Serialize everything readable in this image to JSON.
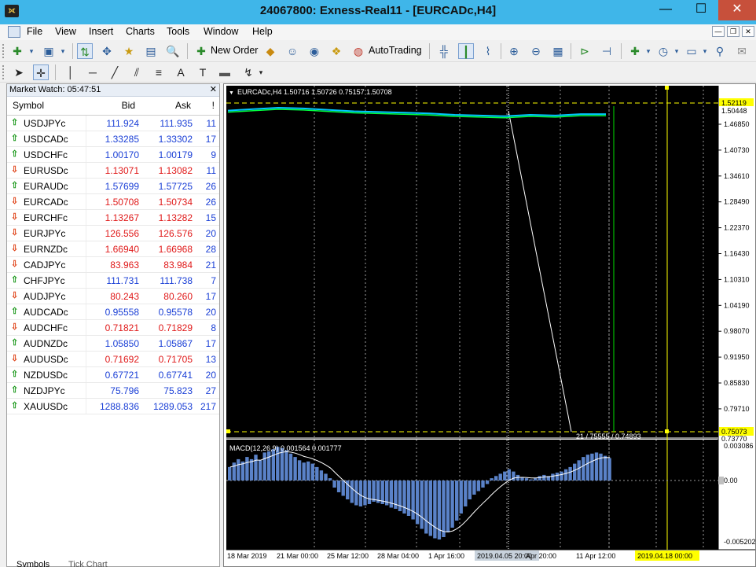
{
  "window": {
    "title": "24067800: Exness-Real11 - [EURCADc,H4]",
    "logo_glyph": "⟗",
    "minimize": "—",
    "maximize": "☐",
    "close": "✕"
  },
  "menu": {
    "items": [
      "File",
      "View",
      "Insert",
      "Charts",
      "Tools",
      "Window",
      "Help"
    ],
    "mdi_minimize": "—",
    "mdi_restore": "❐",
    "mdi_close": "✕"
  },
  "toolbar": {
    "new_order": "New Order",
    "autotrading": "AutoTrading"
  },
  "market_watch": {
    "title": "Market Watch: 05:47:51",
    "close": "✕",
    "columns": {
      "symbol": "Symbol",
      "bid": "Bid",
      "ask": "Ask",
      "spread": "!"
    },
    "rows": [
      {
        "symbol": "USDJPYc",
        "dir": "up",
        "bid": "111.924",
        "ask": "111.935",
        "spread": "11",
        "color": "blue"
      },
      {
        "symbol": "USDCADc",
        "dir": "up",
        "bid": "1.33285",
        "ask": "1.33302",
        "spread": "17",
        "color": "blue"
      },
      {
        "symbol": "USDCHFc",
        "dir": "up",
        "bid": "1.00170",
        "ask": "1.00179",
        "spread": "9",
        "color": "blue"
      },
      {
        "symbol": "EURUSDc",
        "dir": "dn",
        "bid": "1.13071",
        "ask": "1.13082",
        "spread": "11",
        "color": "red"
      },
      {
        "symbol": "EURAUDc",
        "dir": "up",
        "bid": "1.57699",
        "ask": "1.57725",
        "spread": "26",
        "color": "blue"
      },
      {
        "symbol": "EURCADc",
        "dir": "dn",
        "bid": "1.50708",
        "ask": "1.50734",
        "spread": "26",
        "color": "red"
      },
      {
        "symbol": "EURCHFc",
        "dir": "dn",
        "bid": "1.13267",
        "ask": "1.13282",
        "spread": "15",
        "color": "red"
      },
      {
        "symbol": "EURJPYc",
        "dir": "dn",
        "bid": "126.556",
        "ask": "126.576",
        "spread": "20",
        "color": "red"
      },
      {
        "symbol": "EURNZDc",
        "dir": "dn",
        "bid": "1.66940",
        "ask": "1.66968",
        "spread": "28",
        "color": "red"
      },
      {
        "symbol": "CADJPYc",
        "dir": "dn",
        "bid": "83.963",
        "ask": "83.984",
        "spread": "21",
        "color": "red"
      },
      {
        "symbol": "CHFJPYc",
        "dir": "up",
        "bid": "111.731",
        "ask": "111.738",
        "spread": "7",
        "color": "blue"
      },
      {
        "symbol": "AUDJPYc",
        "dir": "dn",
        "bid": "80.243",
        "ask": "80.260",
        "spread": "17",
        "color": "red"
      },
      {
        "symbol": "AUDCADc",
        "dir": "up",
        "bid": "0.95558",
        "ask": "0.95578",
        "spread": "20",
        "color": "blue"
      },
      {
        "symbol": "AUDCHFc",
        "dir": "dn",
        "bid": "0.71821",
        "ask": "0.71829",
        "spread": "8",
        "color": "red"
      },
      {
        "symbol": "AUDNZDc",
        "dir": "up",
        "bid": "1.05850",
        "ask": "1.05867",
        "spread": "17",
        "color": "blue"
      },
      {
        "symbol": "AUDUSDc",
        "dir": "dn",
        "bid": "0.71692",
        "ask": "0.71705",
        "spread": "13",
        "color": "red"
      },
      {
        "symbol": "NZDUSDc",
        "dir": "up",
        "bid": "0.67721",
        "ask": "0.67741",
        "spread": "20",
        "color": "blue"
      },
      {
        "symbol": "NZDJPYc",
        "dir": "up",
        "bid": "75.796",
        "ask": "75.823",
        "spread": "27",
        "color": "blue"
      },
      {
        "symbol": "XAUUSDc",
        "dir": "up",
        "bid": "1288.836",
        "ask": "1289.053",
        "spread": "217",
        "color": "blue"
      }
    ],
    "tabs": [
      "Symbols",
      "Tick Chart"
    ]
  },
  "chart": {
    "symbol_header": "EURCADc,H4  1.50716 1.50726 0.75157 1.50708",
    "price_labels": [
      "1.46850",
      "1.40730",
      "1.34610",
      "1.28490",
      "1.22370",
      "1.16430",
      "1.10310",
      "1.04190",
      "0.98070",
      "0.91950",
      "0.85830",
      "0.79710"
    ],
    "price_tag_top": "1.52119",
    "price_tag_bid": "1.50448",
    "price_tag_low": "0.75073",
    "price_tag_low2": "0.73770",
    "crosshair_readout": "21 / 75555 / 0.74893",
    "macd_label": "MACD(12,26,9) 0.001564 0.001777",
    "macd_scale": [
      "0.003086",
      "0.00",
      "-0.005202"
    ],
    "time_labels": [
      "18 Mar 2019",
      "21 Mar 00:00",
      "25 Mar 12:00",
      "28 Mar 04:00",
      "1 Apr 16:00",
      "2019.04.05 20:00",
      "Apr 20:00",
      "11 Apr 12:00",
      "2019.04.18 00:00"
    ],
    "colors": {
      "background": "#000000",
      "grid": "#c8c8c8",
      "line": "#00ff40",
      "ask_line": "#00c8ff",
      "crosshair": "#ffffff",
      "vline_green": "#00e000",
      "vline_yellow": "#ffff00",
      "macd_hist": "#5a82c8",
      "macd_signal": "#ffffff"
    }
  },
  "chart_data": {
    "type": "line",
    "series": [
      {
        "name": "",
        "values": [
          1.512,
          1.514,
          1.516,
          1.515,
          1.513,
          1.511,
          1.51,
          1.509,
          1.508,
          1.506,
          1.505,
          1.504,
          1.506,
          1.505,
          1.507,
          1.507
        ]
      }
    ],
    "macd": {
      "histogram": [
        0.0012,
        0.0016,
        0.0019,
        0.0017,
        0.0021,
        0.0019,
        0.0023,
        0.0018,
        0.0025,
        0.0026,
        0.0028,
        0.003,
        0.0029,
        0.0027,
        0.0024,
        0.0021,
        0.0018,
        0.0016,
        0.0017,
        0.0015,
        0.0012,
        0.0009,
        0.0006,
        0.0002,
        -0.0006,
        -0.001,
        -0.0013,
        -0.0016,
        -0.0019,
        -0.0021,
        -0.0022,
        -0.0021,
        -0.002,
        -0.0018,
        -0.0019,
        -0.002,
        -0.0021,
        -0.0023,
        -0.0024,
        -0.0026,
        -0.0028,
        -0.003,
        -0.0033,
        -0.0037,
        -0.0041,
        -0.0045,
        -0.0047,
        -0.0049,
        -0.005,
        -0.0048,
        -0.0044,
        -0.004,
        -0.0034,
        -0.0028,
        -0.0022,
        -0.0016,
        -0.0012,
        -0.0009,
        -0.0006,
        -0.0003,
        0.0002,
        0.0004,
        0.0006,
        0.0008,
        0.001,
        0.0008,
        0.0005,
        0.0003,
        0.0002,
        0.0001,
        0.0002,
        0.0004,
        0.0005,
        0.0004,
        0.0006,
        0.0007,
        0.0008,
        0.001,
        0.0012,
        0.0015,
        0.0018,
        0.0021,
        0.0023,
        0.0024,
        0.0025,
        0.0024,
        0.0022,
        0.002
      ],
      "ylim": [
        -0.005202,
        0.003086
      ]
    }
  }
}
